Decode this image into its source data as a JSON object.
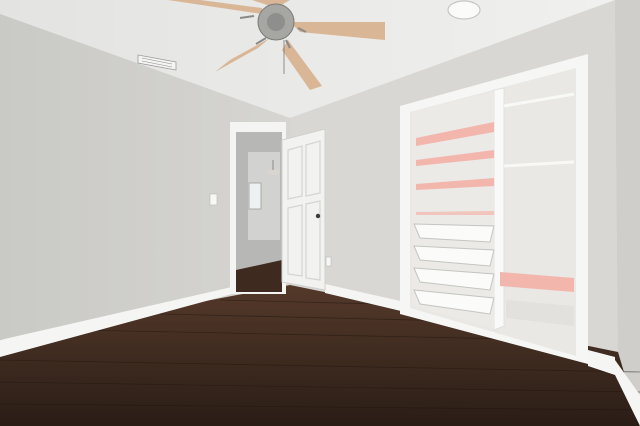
{
  "colors": {
    "ceiling": "#e9e9e7",
    "wall_left": "#cfcfcb",
    "wall_back": "#d9d8d4",
    "wall_right": "#d2d1cd",
    "floor_dark": "#2f2119",
    "floor_mid": "#4a3324",
    "trim": "#f6f6f4",
    "door": "#f1f1ef",
    "closet_interior": "#ecebe7",
    "closet_shelf_pink": "#f2b8b0",
    "wire_basket": "#ffffff",
    "fan_blade": "#d9b89a",
    "fan_metal": "#9a9a98"
  },
  "icons": [
    "ceiling-fan-icon",
    "light-fixture-icon",
    "air-vent-icon",
    "door-knob-icon"
  ]
}
